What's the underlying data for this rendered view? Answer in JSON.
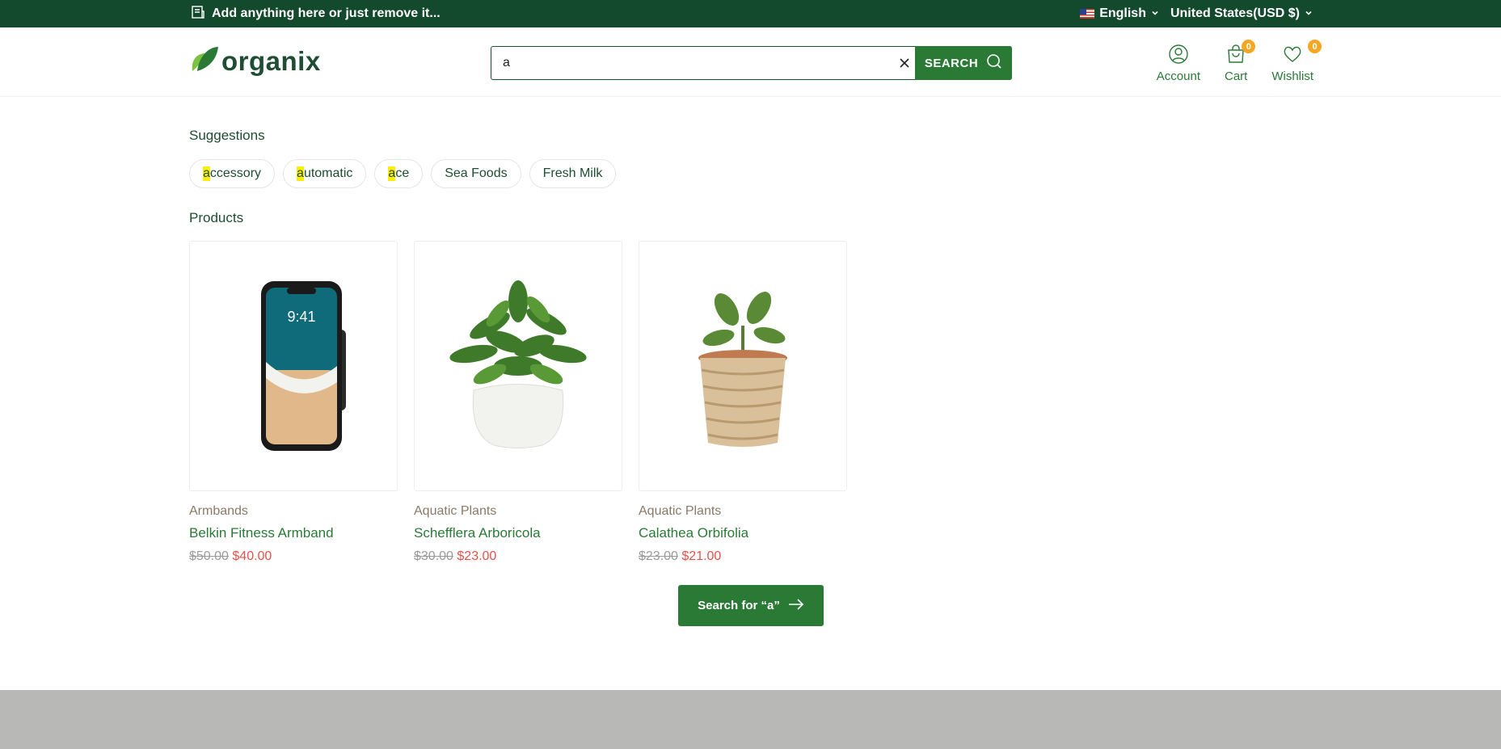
{
  "topbar": {
    "announcement": "Add anything here or just remove it...",
    "language": "English",
    "currency": "United States(USD $)"
  },
  "header": {
    "logo_text": "organix",
    "search": {
      "value": "a",
      "button_label": "SEARCH"
    },
    "account_label": "Account",
    "cart_label": "Cart",
    "cart_count": "0",
    "wishlist_label": "Wishlist",
    "wishlist_count": "0"
  },
  "suggestions": {
    "title": "Suggestions",
    "items": [
      {
        "highlight": "a",
        "rest": "ccessory"
      },
      {
        "highlight": "a",
        "rest": "utomatic"
      },
      {
        "highlight": "a",
        "rest": "ce"
      },
      {
        "highlight": "",
        "rest": "Sea Foods"
      },
      {
        "highlight": "",
        "rest": "Fresh Milk"
      }
    ]
  },
  "products": {
    "title": "Products",
    "items": [
      {
        "category": "Armbands",
        "name": "Belkin Fitness Armband",
        "old_price": "$50.00",
        "new_price": "$40.00",
        "image_icon": "phone-armband"
      },
      {
        "category": "Aquatic Plants",
        "name": "Schefflera Arboricola",
        "old_price": "$30.00",
        "new_price": "$23.00",
        "image_icon": "potted-plant-white"
      },
      {
        "category": "Aquatic Plants",
        "name": "Calathea Orbifolia",
        "old_price": "$23.00",
        "new_price": "$21.00",
        "image_icon": "potted-plant-wicker"
      }
    ]
  },
  "search_for_label": "Search for “a”",
  "colors": {
    "primary": "#2a7a36",
    "dark": "#134a2e",
    "badge": "#f5a623",
    "sale": "#e0534a"
  }
}
